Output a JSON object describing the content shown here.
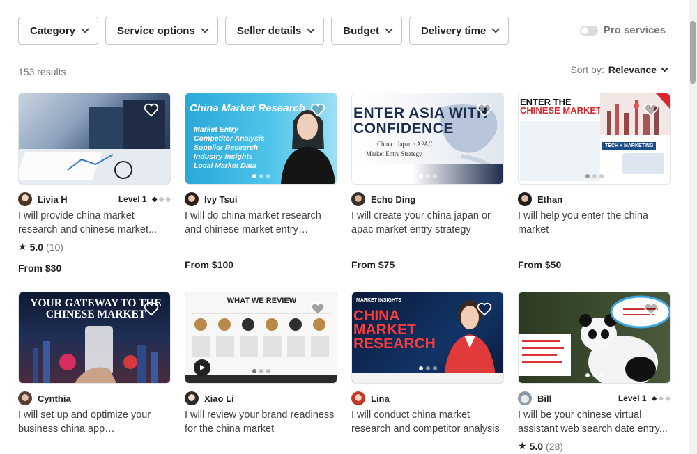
{
  "filters": [
    {
      "label": "Category"
    },
    {
      "label": "Service options"
    },
    {
      "label": "Seller details"
    },
    {
      "label": "Budget"
    },
    {
      "label": "Delivery time"
    }
  ],
  "pro_services_label": "Pro services",
  "results_count": "153 results",
  "sort": {
    "label": "Sort by:",
    "value": "Relevance"
  },
  "gigs": [
    {
      "seller": "Livia H",
      "level": "Level 1",
      "title": "I will provide china market research and chinese market...",
      "rating": "5.0",
      "reviews": "(10)",
      "price": "From $30"
    },
    {
      "seller": "Ivy Tsui",
      "title": "I will do china market research and chinese market entry consulting",
      "price": "From $100",
      "img_title": "China Market Research",
      "img_bullets": [
        "Market Entry",
        "Competitor Analysis",
        "Supplier Research",
        "Industry Insights",
        "Local Market Data"
      ]
    },
    {
      "seller": "Echo Ding",
      "title": "I will create your china japan or apac market entry strategy",
      "price": "From $75",
      "img_title": "ENTER ASIA WITH CONFIDENCE",
      "img_sub": "China · Japan · APAC",
      "img_caption": "Market Entry Strategy"
    },
    {
      "seller": "Ethan",
      "title": "I will help you enter the china market",
      "price": "From $50",
      "img_title_1": "ENTER THE",
      "img_title_2": "CHINESE MARKET",
      "img_badge": "TECH + MARKETING"
    },
    {
      "seller": "Cynthia",
      "title": "I will set up and optimize your business china app xiaohongshu,...",
      "img_title": "YOUR GATEWAY TO THE CHINESE MARKET"
    },
    {
      "seller": "Xiao Li",
      "title": "I will review your brand readiness for the china market",
      "img_title": "WHAT WE REVIEW"
    },
    {
      "seller": "Lina",
      "title": "I will conduct china market research and competitor analysis",
      "img_kicker": "MARKET INSIGHTS",
      "img_title": "CHINA MARKET RESEARCH"
    },
    {
      "seller": "Bill",
      "level": "Level 1",
      "title": "I will be your chinese virtual assistant web search date entry...",
      "rating": "5.0",
      "reviews": "(28)"
    }
  ]
}
